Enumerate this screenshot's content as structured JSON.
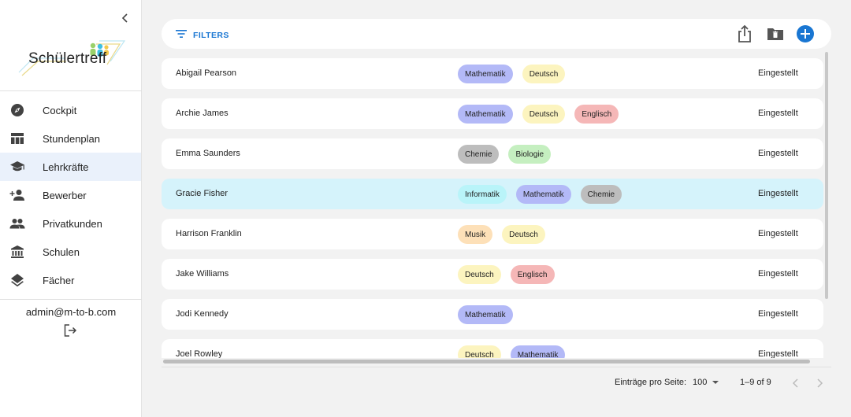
{
  "sidebar": {
    "logo_text": "Schülertreff",
    "items": [
      {
        "label": "Cockpit",
        "icon": "compass-icon",
        "active": false
      },
      {
        "label": "Stundenplan",
        "icon": "table-icon",
        "active": false
      },
      {
        "label": "Lehrkräfte",
        "icon": "school-cap-icon",
        "active": true
      },
      {
        "label": "Bewerber",
        "icon": "person-add-icon",
        "active": false
      },
      {
        "label": "Privatkunden",
        "icon": "people-icon",
        "active": false
      },
      {
        "label": "Schulen",
        "icon": "bank-icon",
        "active": false
      },
      {
        "label": "Fächer",
        "icon": "layers-icon",
        "active": false
      }
    ],
    "user_email": "admin@m-to-b.com"
  },
  "toolbar": {
    "filters_label": "FILTERS"
  },
  "colors": {
    "accent": "#1976d2",
    "selected_row": "#d5f3fb",
    "active_nav": "#eaf1fb"
  },
  "subject_colors": {
    "Mathematik": "#b3b9f7",
    "Deutsch": "#fcf4bf",
    "Englisch": "#f5b7b7",
    "Chemie": "#bdbdbd",
    "Biologie": "#c5efc0",
    "Informatik": "#b9f4f9",
    "Musik": "#fde0b8"
  },
  "table": {
    "rows": [
      {
        "name": "Abigail Pearson",
        "subjects": [
          "Mathematik",
          "Deutsch"
        ],
        "status": "Eingestellt",
        "selected": false
      },
      {
        "name": "Archie James",
        "subjects": [
          "Mathematik",
          "Deutsch",
          "Englisch"
        ],
        "status": "Eingestellt",
        "selected": false
      },
      {
        "name": "Emma Saunders",
        "subjects": [
          "Chemie",
          "Biologie"
        ],
        "status": "Eingestellt",
        "selected": false
      },
      {
        "name": "Gracie Fisher",
        "subjects": [
          "Informatik",
          "Mathematik",
          "Chemie"
        ],
        "status": "Eingestellt",
        "selected": true
      },
      {
        "name": "Harrison Franklin",
        "subjects": [
          "Musik",
          "Deutsch"
        ],
        "status": "Eingestellt",
        "selected": false
      },
      {
        "name": "Jake Williams",
        "subjects": [
          "Deutsch",
          "Englisch"
        ],
        "status": "Eingestellt",
        "selected": false
      },
      {
        "name": "Jodi Kennedy",
        "subjects": [
          "Mathematik"
        ],
        "status": "Eingestellt",
        "selected": false
      },
      {
        "name": "Joel Rowley",
        "subjects": [
          "Deutsch",
          "Mathematik"
        ],
        "status": "Eingestellt",
        "selected": false
      }
    ]
  },
  "pagination": {
    "rows_per_page_label": "Einträge pro Seite:",
    "rows_per_page_value": "100",
    "range_label": "1–9 of 9"
  }
}
